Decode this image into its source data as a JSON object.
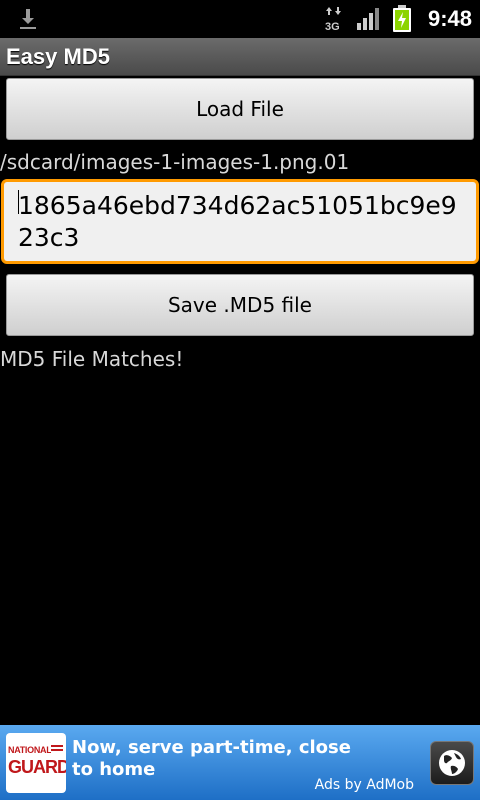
{
  "status_bar": {
    "time": "9:48",
    "network_label": "3G",
    "icons": [
      "download-icon",
      "network-3g-icon",
      "signal-icon",
      "battery-charging-icon"
    ]
  },
  "app": {
    "title": "Easy MD5"
  },
  "main": {
    "load_button_label": "Load File",
    "file_path": "/sdcard/images-1-images-1.png.01",
    "hash_value": "1865a46ebd734d62ac51051bc9e923c3",
    "save_button_label": "Save .MD5 file",
    "result_text": "MD5 File Matches!"
  },
  "ad": {
    "logo_line1": "NATIONAL",
    "logo_line2": "GUARD",
    "text": "Now, serve part-time, close to home",
    "attribution": "Ads by AdMob",
    "icon": "globe-icon"
  },
  "colors": {
    "accent": "#ff9a00",
    "ad_background": "#2f86dd",
    "battery": "#8cd400"
  }
}
